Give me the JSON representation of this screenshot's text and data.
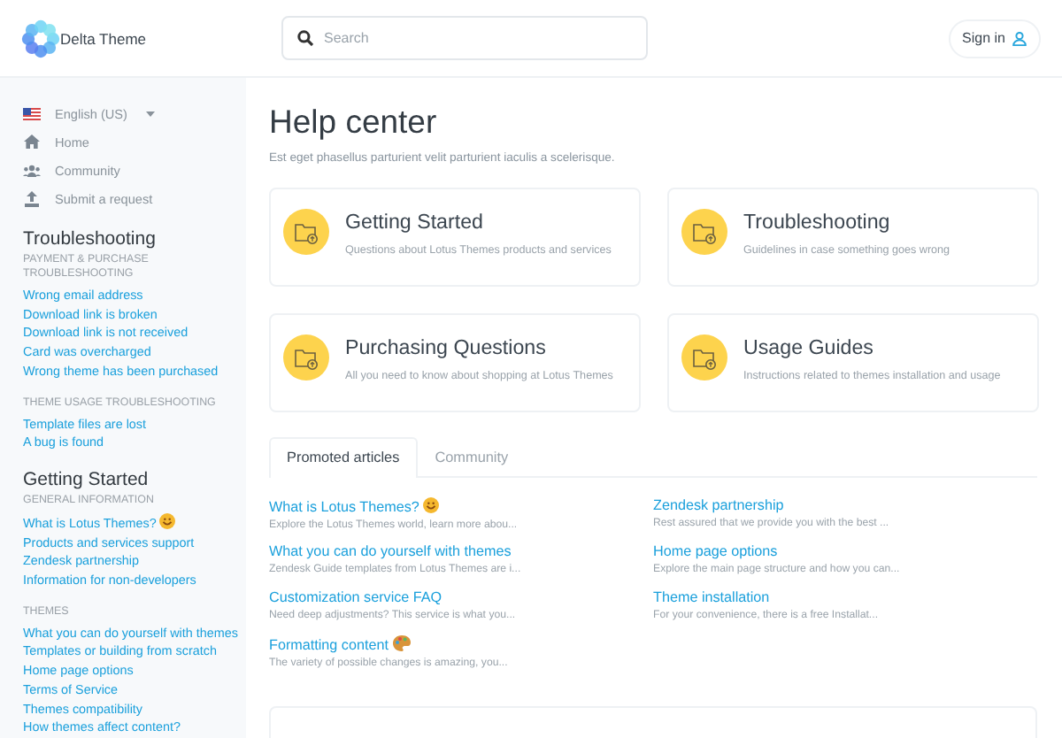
{
  "header": {
    "brand": "Delta Theme",
    "search": {
      "placeholder": "Search"
    },
    "sign_in": "Sign in"
  },
  "sidebar": {
    "language": "English (US)",
    "nav": [
      {
        "label": "Home"
      },
      {
        "label": "Community"
      },
      {
        "label": "Submit a request"
      }
    ],
    "sections": [
      {
        "title": "Troubleshooting",
        "groups": [
          {
            "heading": "PAYMENT & PURCHASE TROUBLESHOOTING",
            "links": [
              {
                "label": "Wrong email address"
              },
              {
                "label": "Download link is broken"
              },
              {
                "label": "Download link is not received"
              },
              {
                "label": "Card was overcharged"
              },
              {
                "label": "Wrong theme has been purchased"
              }
            ]
          },
          {
            "heading": "THEME USAGE TROUBLESHOOTING",
            "links": [
              {
                "label": "Template files are lost"
              },
              {
                "label": "A bug is found"
              }
            ]
          }
        ]
      },
      {
        "title": "Getting Started",
        "groups": [
          {
            "heading": "GENERAL INFORMATION",
            "links": [
              {
                "label": "What is Lotus Themes?",
                "kind": "smiley"
              },
              {
                "label": "Products and services support"
              },
              {
                "label": "Zendesk partnership"
              },
              {
                "label": "Information for non-developers"
              }
            ]
          },
          {
            "heading": "THEMES",
            "links": [
              {
                "label": "What you can do yourself with themes"
              },
              {
                "label": "Templates or building from scratch"
              },
              {
                "label": "Home page options"
              },
              {
                "label": "Terms of Service"
              },
              {
                "label": "Themes compatibility"
              },
              {
                "label": "How themes affect content?"
              }
            ]
          }
        ]
      }
    ]
  },
  "main": {
    "title": "Help center",
    "subtitle": "Est eget phasellus parturient velit parturient iaculis a scelerisque.",
    "categories": [
      {
        "title": "Getting Started",
        "description": "Questions about Lotus Themes products and services"
      },
      {
        "title": "Troubleshooting",
        "description": "Guidelines in case something goes wrong"
      },
      {
        "title": "Purchasing Questions",
        "description": "All you need to know about shopping at Lotus Themes"
      },
      {
        "title": "Usage Guides",
        "description": "Instructions related to themes installation and usage"
      }
    ],
    "tabs": [
      {
        "label": "Promoted articles",
        "selected": true
      },
      {
        "label": "Community",
        "selected": false
      }
    ],
    "article_columns": [
      [
        {
          "title": "What is Lotus Themes?",
          "excerpt": "Explore the Lotus Themes world, learn more abou...",
          "kind": "smiley"
        },
        {
          "title": "What you can do yourself with themes",
          "excerpt": "Zendesk Guide templates from Lotus Themes are i..."
        },
        {
          "title": "Customization service FAQ",
          "excerpt": "Need deep adjustments? This service is what you..."
        },
        {
          "title": "Formatting content",
          "excerpt": "The variety of possible changes is amazing, you...",
          "kind": "palette"
        }
      ],
      [
        {
          "title": "Zendesk partnership",
          "excerpt": "Rest assured that we provide you with the best ..."
        },
        {
          "title": "Home page options",
          "excerpt": "Explore the main page structure and how you can..."
        },
        {
          "title": "Theme installation",
          "excerpt": "For your convenience, there is a free Installat..."
        }
      ]
    ]
  }
}
